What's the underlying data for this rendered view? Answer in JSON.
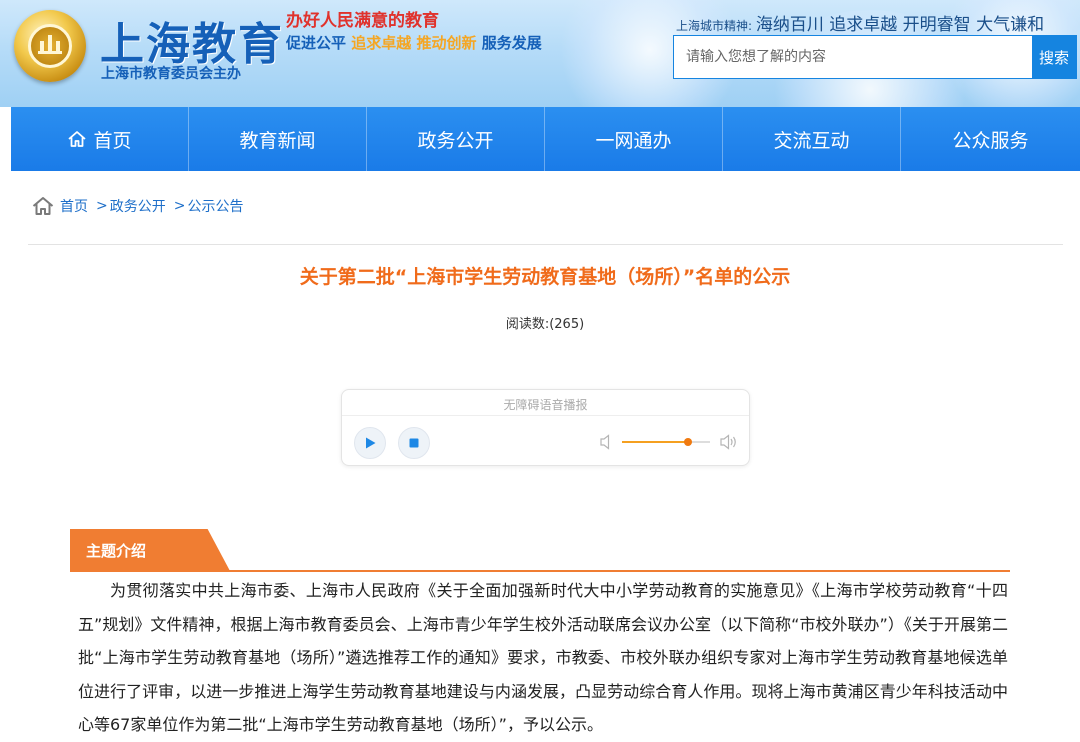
{
  "header": {
    "site_title": "上海教育",
    "site_subtitle": "上海市教育委员会主办",
    "slogan_line1": "办好人民满意的教育",
    "slogan_line2_parts": [
      "促进公平",
      "追求卓越",
      "推动创新",
      "服务发展"
    ],
    "city_spirit_label": "上海城市精神:",
    "city_spirit_text": "海纳百川 追求卓越 开明睿智 大气谦和",
    "search_placeholder": "请输入您想了解的内容",
    "search_button": "搜索"
  },
  "nav": {
    "items": [
      {
        "label": "首页",
        "icon": "home-icon"
      },
      {
        "label": "教育新闻"
      },
      {
        "label": "政务公开"
      },
      {
        "label": "一网通办"
      },
      {
        "label": "交流互动"
      },
      {
        "label": "公众服务"
      }
    ]
  },
  "breadcrumb": {
    "icon": "home-outline-icon",
    "items": [
      "首页",
      "政务公开",
      "公示公告"
    ],
    "separator": ">"
  },
  "article": {
    "title": "关于第二批“上海市学生劳动教育基地（场所）”名单的公示",
    "read_count": "阅读数:(265)"
  },
  "player": {
    "title": "无障碍语音播报",
    "play_icon": "play-icon",
    "stop_icon": "stop-icon",
    "volume_level": 0.75
  },
  "topic": {
    "label": "主题介绍",
    "body": "为贯彻落实中共上海市委、上海市人民政府《关于全面加强新时代大中小学劳动教育的实施意见》《上海市学校劳动教育“十四五”规划》文件精神，根据上海市教育委员会、上海市青少年学生校外活动联席会议办公室（以下简称“市校外联办”）《关于开展第二批“上海市学生劳动教育基地（场所）”遴选推荐工作的通知》要求，市教委、市校外联办组织专家对上海市学生劳动教育基地候选单位进行了评审，以进一步推进上海学生劳动教育基地建设与内涵发展，凸显劳动综合育人作用。现将上海市黄浦区青少年科技活动中心等67家单位作为第二批“上海市学生劳动教育基地（场所）”，予以公示。"
  },
  "colors": {
    "brand_blue": "#1584e0",
    "nav_blue": "#1a7be8",
    "title_orange": "#f06b1b",
    "tag_orange": "#f07d32",
    "slogan_red": "#e0322c"
  }
}
